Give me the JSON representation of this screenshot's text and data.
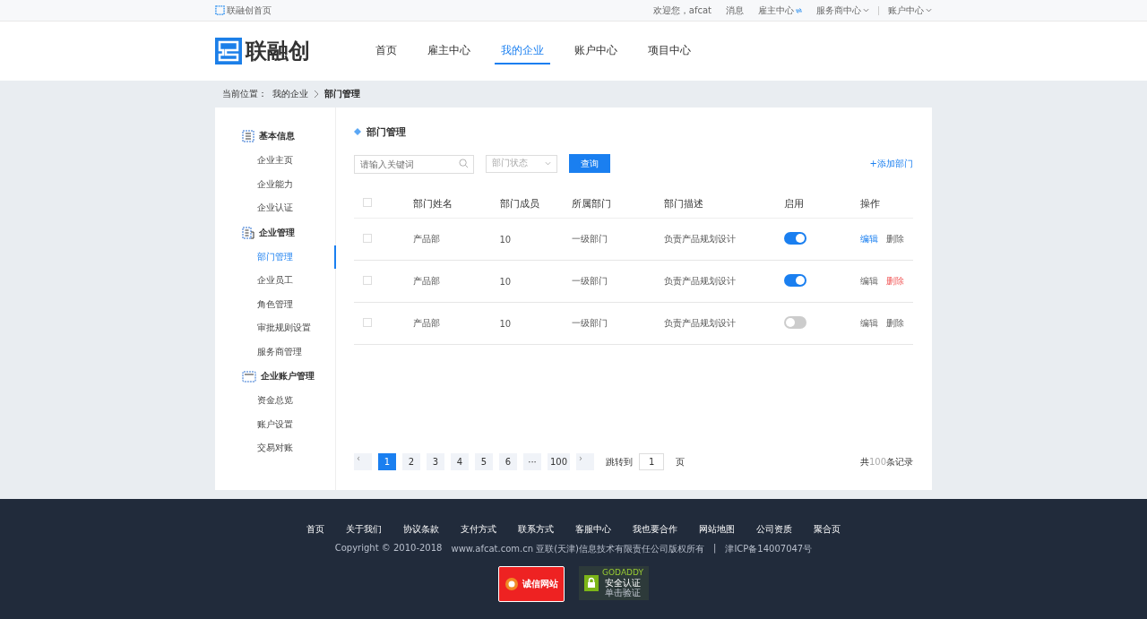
{
  "top_bar": {
    "home_link": "联融创首页",
    "welcome": "欢迎您，afcat",
    "links": [
      {
        "label": "消息",
        "kind": "plain"
      },
      {
        "label": "雇主中心",
        "kind": "switch"
      },
      {
        "label": "服务商中心",
        "kind": "dropdown"
      },
      {
        "label": "账户中心",
        "kind": "dropdown"
      }
    ]
  },
  "header": {
    "logo": "联融创",
    "nav": [
      {
        "label": "首页",
        "selected": false
      },
      {
        "label": "雇主中心",
        "selected": false
      },
      {
        "label": "我的企业",
        "selected": true
      },
      {
        "label": "账户中心",
        "selected": false
      },
      {
        "label": "项目中心",
        "selected": false
      }
    ]
  },
  "breadcrumb": {
    "label": "当前位置：",
    "items": [
      "我的企业"
    ],
    "current": "部门管理"
  },
  "sidebar": [
    {
      "title": "基本信息",
      "items": [
        {
          "label": "企业主页",
          "selected": false
        },
        {
          "label": "企业能力",
          "selected": false
        },
        {
          "label": "企业认证",
          "selected": false
        }
      ]
    },
    {
      "title": "企业管理",
      "items": [
        {
          "label": "部门管理",
          "selected": true
        },
        {
          "label": "企业员工",
          "selected": false
        },
        {
          "label": "角色管理",
          "selected": false
        },
        {
          "label": "审批规则设置",
          "selected": false
        },
        {
          "label": "服务商管理",
          "selected": false
        }
      ]
    },
    {
      "title": "企业账户管理",
      "items": [
        {
          "label": "资金总览",
          "selected": false
        },
        {
          "label": "账户设置",
          "selected": false
        },
        {
          "label": "交易对账",
          "selected": false
        }
      ]
    }
  ],
  "main": {
    "title": "部门管理",
    "search": {
      "placeholder": "请输入关键词"
    },
    "status_select": {
      "placeholder": "部门状态"
    },
    "query_button": "查询",
    "add_link": "+添加部门",
    "table": {
      "columns": [
        "部门姓名",
        "部门成员",
        "所属部门",
        "部门描述",
        "启用",
        "操作"
      ],
      "header_checked": false,
      "rows": [
        {
          "checked": false,
          "name": "产品部",
          "members": "10",
          "parent": "一级部门",
          "description": "负责产品规划设计",
          "enabled": true,
          "actions": [
            {
              "label": "编辑",
              "kind": "link"
            },
            {
              "label": "删除",
              "kind": "plain"
            }
          ]
        },
        {
          "checked": false,
          "name": "产品部",
          "members": "10",
          "parent": "一级部门",
          "description": "负责产品规划设计",
          "enabled": true,
          "actions": [
            {
              "label": "编辑",
              "kind": "plain"
            },
            {
              "label": "删除",
              "kind": "danger"
            }
          ]
        },
        {
          "checked": false,
          "name": "产品部",
          "members": "10",
          "parent": "一级部门",
          "description": "负责产品规划设计",
          "enabled": false,
          "actions": [
            {
              "label": "编辑",
              "kind": "plain"
            },
            {
              "label": "删除",
              "kind": "plain"
            }
          ]
        }
      ]
    },
    "pagination": {
      "prev": "‹",
      "pages": [
        {
          "label": "1",
          "selected": true
        },
        {
          "label": "2",
          "selected": false
        },
        {
          "label": "3",
          "selected": false
        },
        {
          "label": "4",
          "selected": false
        },
        {
          "label": "5",
          "selected": false
        },
        {
          "label": "6",
          "selected": false
        },
        {
          "label": "···",
          "selected": false
        },
        {
          "label": "100",
          "selected": false
        }
      ],
      "next": "›",
      "jump_label": "跳转到",
      "jump_value": "1",
      "jump_unit": "页",
      "total_prefix": "共",
      "total_count": "100",
      "total_suffix": "条记录"
    }
  },
  "footer": {
    "links": [
      "首页",
      "关于我们",
      "协议条款",
      "支付方式",
      "联系方式",
      "客服中心",
      "我也要合作",
      "网站地图",
      "公司资质",
      "聚合页"
    ],
    "copyright": "Copyright © 2010-2018",
    "site": "www.afcat.com.cn 亚联(天津)信息技术有限责任公司版权所有",
    "separator": "|",
    "icp": "津ICP备14007047号",
    "badges": [
      {
        "kind": "trust",
        "texts": [
          "诚信网站"
        ]
      },
      {
        "kind": "secure",
        "texts": [
          "GODADDY",
          "安全认证",
          "单击验证"
        ]
      }
    ]
  }
}
